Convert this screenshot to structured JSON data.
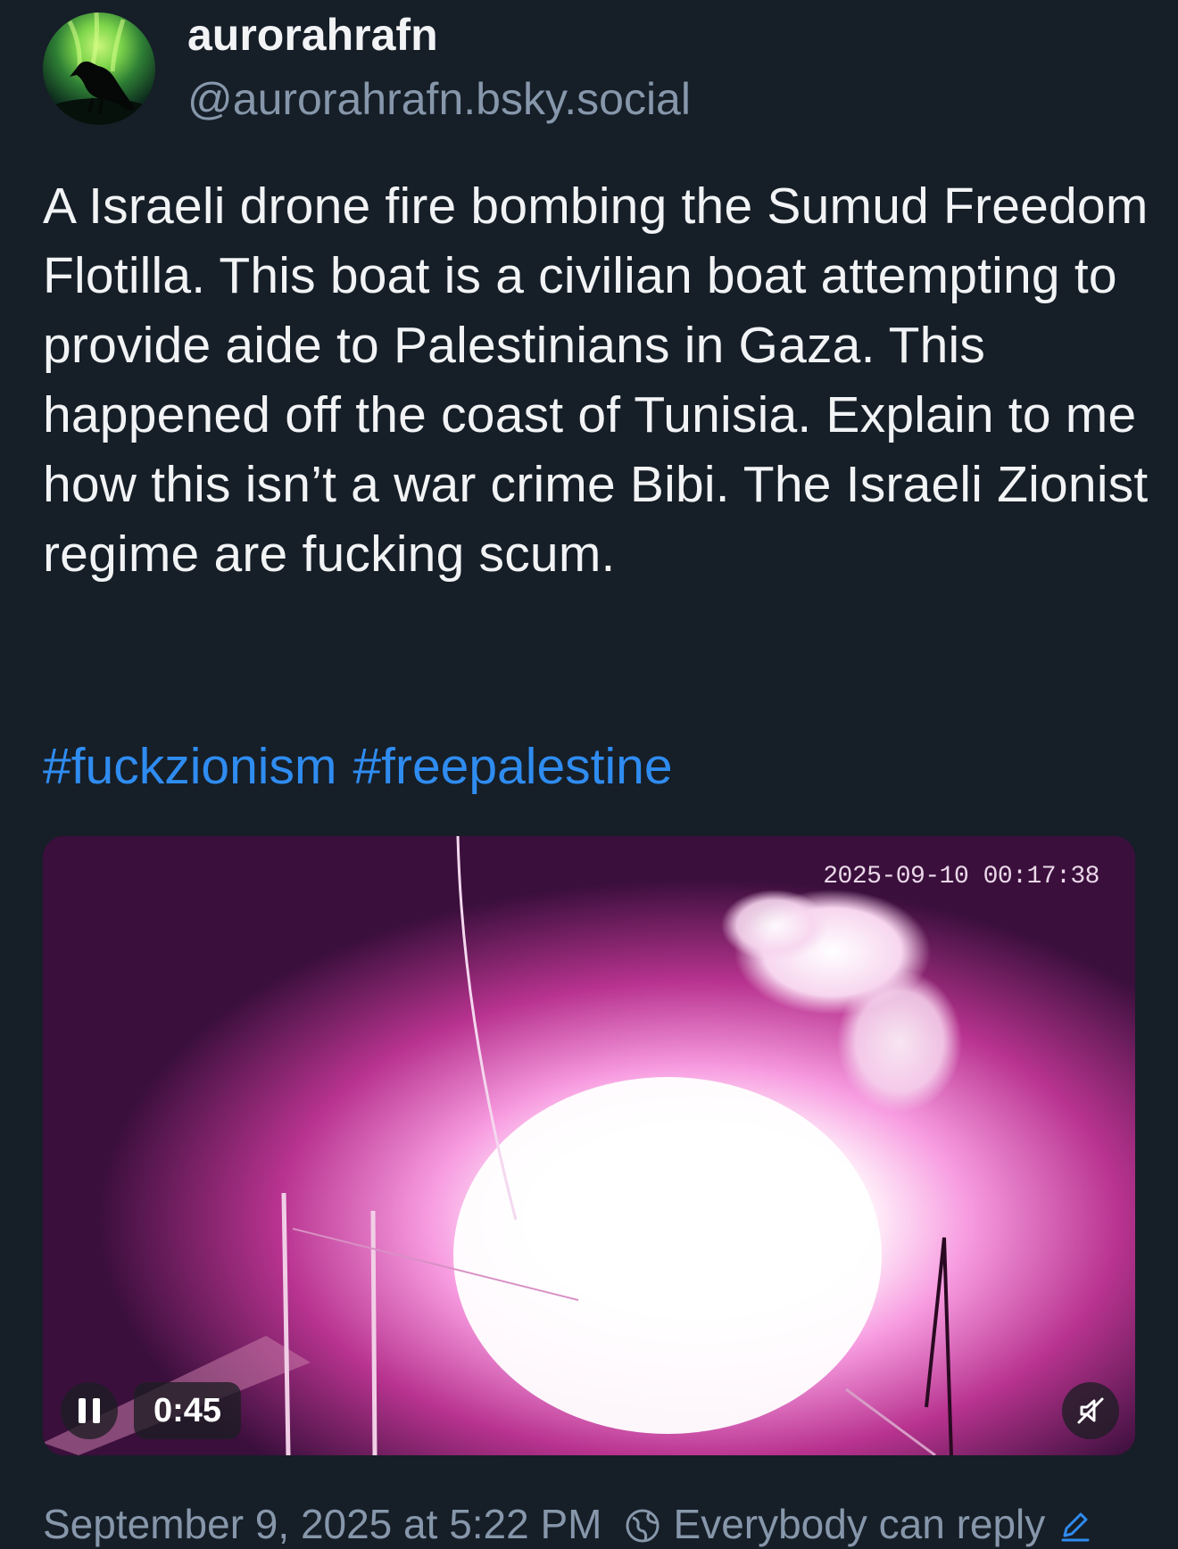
{
  "author": {
    "display_name": "aurorahrafn",
    "handle": "@aurorahrafn.bsky.social",
    "avatar_icon": "raven-aurora-avatar"
  },
  "post": {
    "text": "A Israeli drone fire bombing the Sumud Freedom Flotilla. This boat is a civilian boat attempting to provide aide to Palestinians in Gaza. This happened off the coast of Tunisia. Explain to me how this isn’t a war crime Bibi. The Israeli Zionist regime are fucking scum.",
    "hashtags": [
      "#fuckzionism",
      "#freepalestine"
    ]
  },
  "video": {
    "overlay_timestamp": "2025-09-10 00:17:38",
    "time_remaining": "0:45",
    "state": "playing",
    "muted": true,
    "pause_icon": "pause-icon",
    "mute_icon": "speaker-muted-icon"
  },
  "footer": {
    "posted_at": "September 9, 2025 at 5:22 PM",
    "reply_setting": "Everybody can reply",
    "globe_icon": "globe-icon",
    "edit_icon": "pencil-icon"
  },
  "colors": {
    "background": "#161e27",
    "text": "#f1f3f5",
    "muted_text": "#8797ab",
    "link": "#2f8cf0"
  }
}
